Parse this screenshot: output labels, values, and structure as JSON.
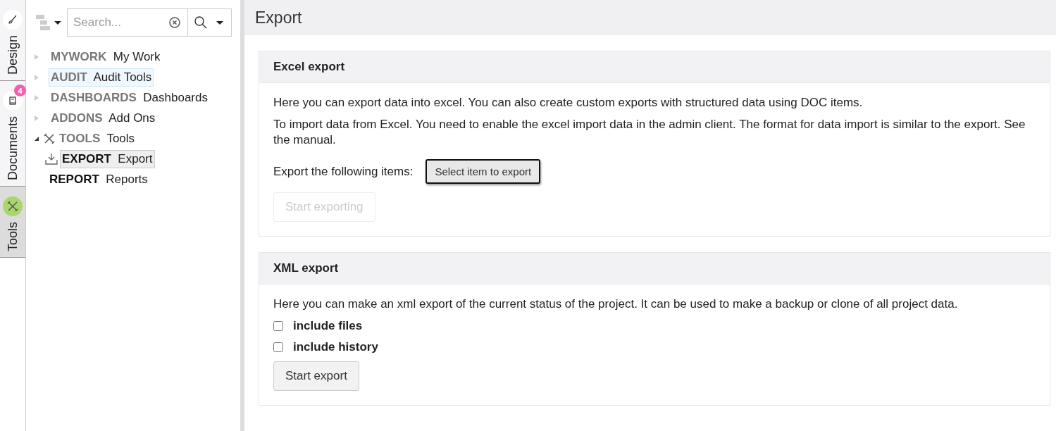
{
  "side_tabs": [
    {
      "label": "Design",
      "kind": "brush",
      "selected": false
    },
    {
      "label": "Documents",
      "kind": "book",
      "badge": "4",
      "selected": false
    },
    {
      "label": "Tools",
      "kind": "tools",
      "selected": true
    }
  ],
  "search": {
    "placeholder": "Search..."
  },
  "tree": [
    {
      "code": "MYWORK",
      "label": "My Work",
      "expanded": false,
      "hovered": false,
      "selected": false
    },
    {
      "code": "AUDIT",
      "label": "Audit Tools",
      "expanded": false,
      "hovered": true,
      "selected": false
    },
    {
      "code": "DASHBOARDS",
      "label": "Dashboards",
      "expanded": false,
      "hovered": false,
      "selected": false
    },
    {
      "code": "ADDONS",
      "label": "Add Ons",
      "expanded": false,
      "hovered": false,
      "selected": false
    },
    {
      "code": "TOOLS",
      "label": "Tools",
      "expanded": true,
      "hovered": false,
      "selected": false,
      "kind": "tools",
      "children": [
        {
          "code": "EXPORT",
          "label": "Export",
          "hovered": false,
          "selected": true,
          "kind": "download"
        },
        {
          "code": "REPORT",
          "label": "Reports",
          "hovered": false,
          "selected": false
        }
      ]
    }
  ],
  "page_title": "Export",
  "excel": {
    "title": "Excel export",
    "paragraphs": [
      "Here you can export data into excel. You can also create custom exports with structured data using DOC items.",
      "To import data from Excel. You need to enable the excel import data in the admin client. The format for data import is similar to the export. See the manual."
    ],
    "select_label": "Export the following items:",
    "select_button": "Select item to export",
    "start_button": {
      "label": "Start exporting",
      "disabled": true
    }
  },
  "xml": {
    "title": "XML export",
    "paragraph": "Here you can make an xml export of the current status of the project. It can be used to make a backup or clone of all project data.",
    "options": [
      {
        "label": "include files",
        "checked": false
      },
      {
        "label": "include history",
        "checked": false
      }
    ],
    "start_button": {
      "label": "Start export",
      "disabled": false
    }
  }
}
